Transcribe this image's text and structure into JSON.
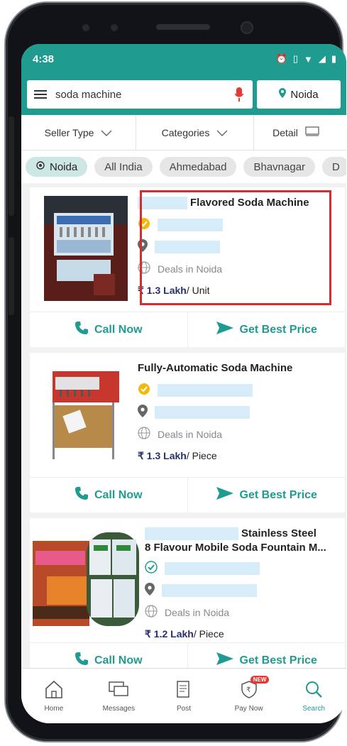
{
  "status": {
    "time": "4:38"
  },
  "search": {
    "query": "soda machine",
    "location": "Noida"
  },
  "filters": [
    {
      "label": "Seller Type"
    },
    {
      "label": "Categories"
    },
    {
      "label": "Detail"
    }
  ],
  "chips": [
    "Noida",
    "All India",
    "Ahmedabad",
    "Bhavnagar",
    "D"
  ],
  "products": [
    {
      "title": "Flavored Soda Machine",
      "deals": "Deals in Noida",
      "price": "₹ 1.3 Lakh",
      "unit": "/ Unit",
      "call_label": "Call Now",
      "price_btn_label": "Get Best Price"
    },
    {
      "title": "Fully-Automatic Soda Machine",
      "deals": "Deals in Noida",
      "price": "₹ 1.3 Lakh",
      "unit": "/ Piece",
      "call_label": "Call Now",
      "price_btn_label": "Get Best Price"
    },
    {
      "title": "Stainless Steel",
      "title_line2": "8 Flavour Mobile Soda Fountain M...",
      "deals": "Deals in Noida",
      "price": "₹ 1.2 Lakh",
      "unit": "/ Piece",
      "call_label": "Call Now",
      "price_btn_label": "Get Best Price"
    }
  ],
  "nav": [
    {
      "label": "Home",
      "icon": "home-icon"
    },
    {
      "label": "Messages",
      "icon": "messages-icon"
    },
    {
      "label": "Post",
      "icon": "post-icon"
    },
    {
      "label": "Pay Now",
      "icon": "pay-now-icon",
      "badge": "NEW"
    },
    {
      "label": "Search",
      "icon": "search-icon"
    }
  ],
  "colors": {
    "brand": "#1f9c8f",
    "price": "#2a2f6e",
    "highlight": "#d32d2d",
    "badge": "#e53935"
  }
}
